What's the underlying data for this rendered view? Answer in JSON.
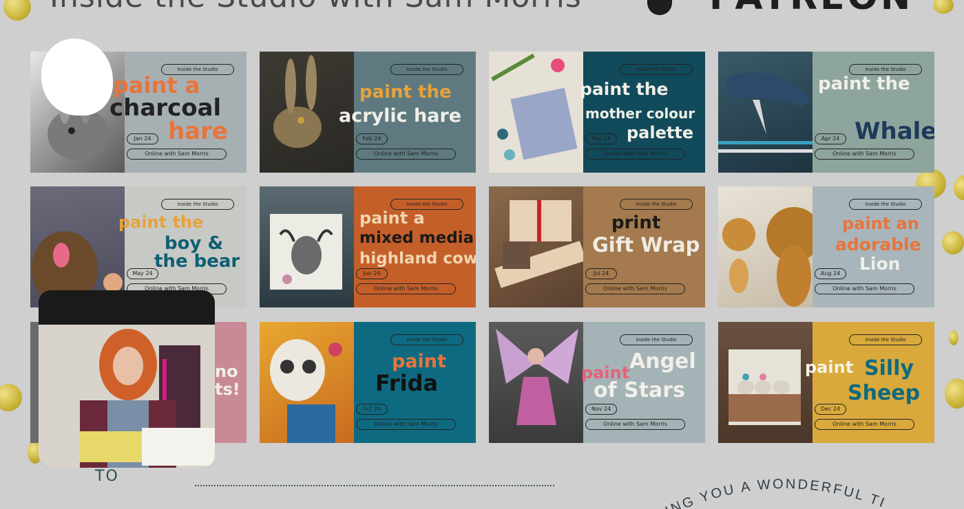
{
  "header": {
    "title": "Inside the Studio with Sam Morris",
    "brand": "PATREON"
  },
  "cards": [
    {
      "tag": "Inside the Studio",
      "line1": "paint a",
      "line2": "charcoal",
      "line3": "hare",
      "date": "Jan 24",
      "online": "Online with Sam Morris"
    },
    {
      "tag": "Inside the Studio",
      "line1": "paint the",
      "line2": "acrylic hare",
      "line3": "",
      "date": "Feb 24",
      "online": "Online with Sam Morris"
    },
    {
      "tag": "Inside the Studio",
      "line1": "paint the",
      "line2": "mother colour",
      "line3": "palette",
      "date": "Mar 24",
      "online": "Online with Sam Morris"
    },
    {
      "tag": "Inside the Studio",
      "line1": "paint the",
      "line2": "Whale",
      "line3": "",
      "date": "Apr 24",
      "online": "Online with Sam Morris"
    },
    {
      "tag": "Inside the Studio",
      "line1": "paint the",
      "line2": "boy &",
      "line3": "the bear",
      "date": "May 24",
      "online": "Online with Sam Morris"
    },
    {
      "tag": "Inside the Studio",
      "line1": "paint a",
      "line2": "mixed media",
      "line3": "highland cow",
      "date": "Jun 24",
      "online": "Online with Sam Morris"
    },
    {
      "tag": "Inside the Studio",
      "line1": "print",
      "line2": "Gift Wrap",
      "line3": "",
      "date": "Jul 24",
      "online": "Online with Sam Morris"
    },
    {
      "tag": "Inside the Studio",
      "line1": "paint an",
      "line2": "adorable",
      "line3": "Lion",
      "date": "Aug 24",
      "online": "Online with Sam Morris"
    },
    {
      "tag": "",
      "line1": "",
      "line2": "no",
      "line3": "ts!",
      "date": "",
      "online": ""
    },
    {
      "tag": "Inside the Studio",
      "line1": "paint",
      "line2": "Frida",
      "line3": "",
      "date": "Oct 24",
      "online": "Online with Sam Morris"
    },
    {
      "tag": "Inside the Studio",
      "line1": "paint",
      "line2": "Angel",
      "line3": "of Stars",
      "date": "Nov 24",
      "online": "Online with Sam Morris"
    },
    {
      "tag": "Inside the Studio",
      "line1": "paint",
      "line2": "Silly",
      "line3": "Sheep",
      "date": "Dec 24",
      "online": "Online with Sam Morris"
    }
  ],
  "footer": {
    "to_label": "TO",
    "arc_text": "ING YOU A WONDERFUL TI"
  },
  "colors": {
    "background": "#cfcfcf",
    "gold": "#c9b43a",
    "orange": "#e8743b",
    "dark": "#222222",
    "teal": "#0e5f73"
  }
}
